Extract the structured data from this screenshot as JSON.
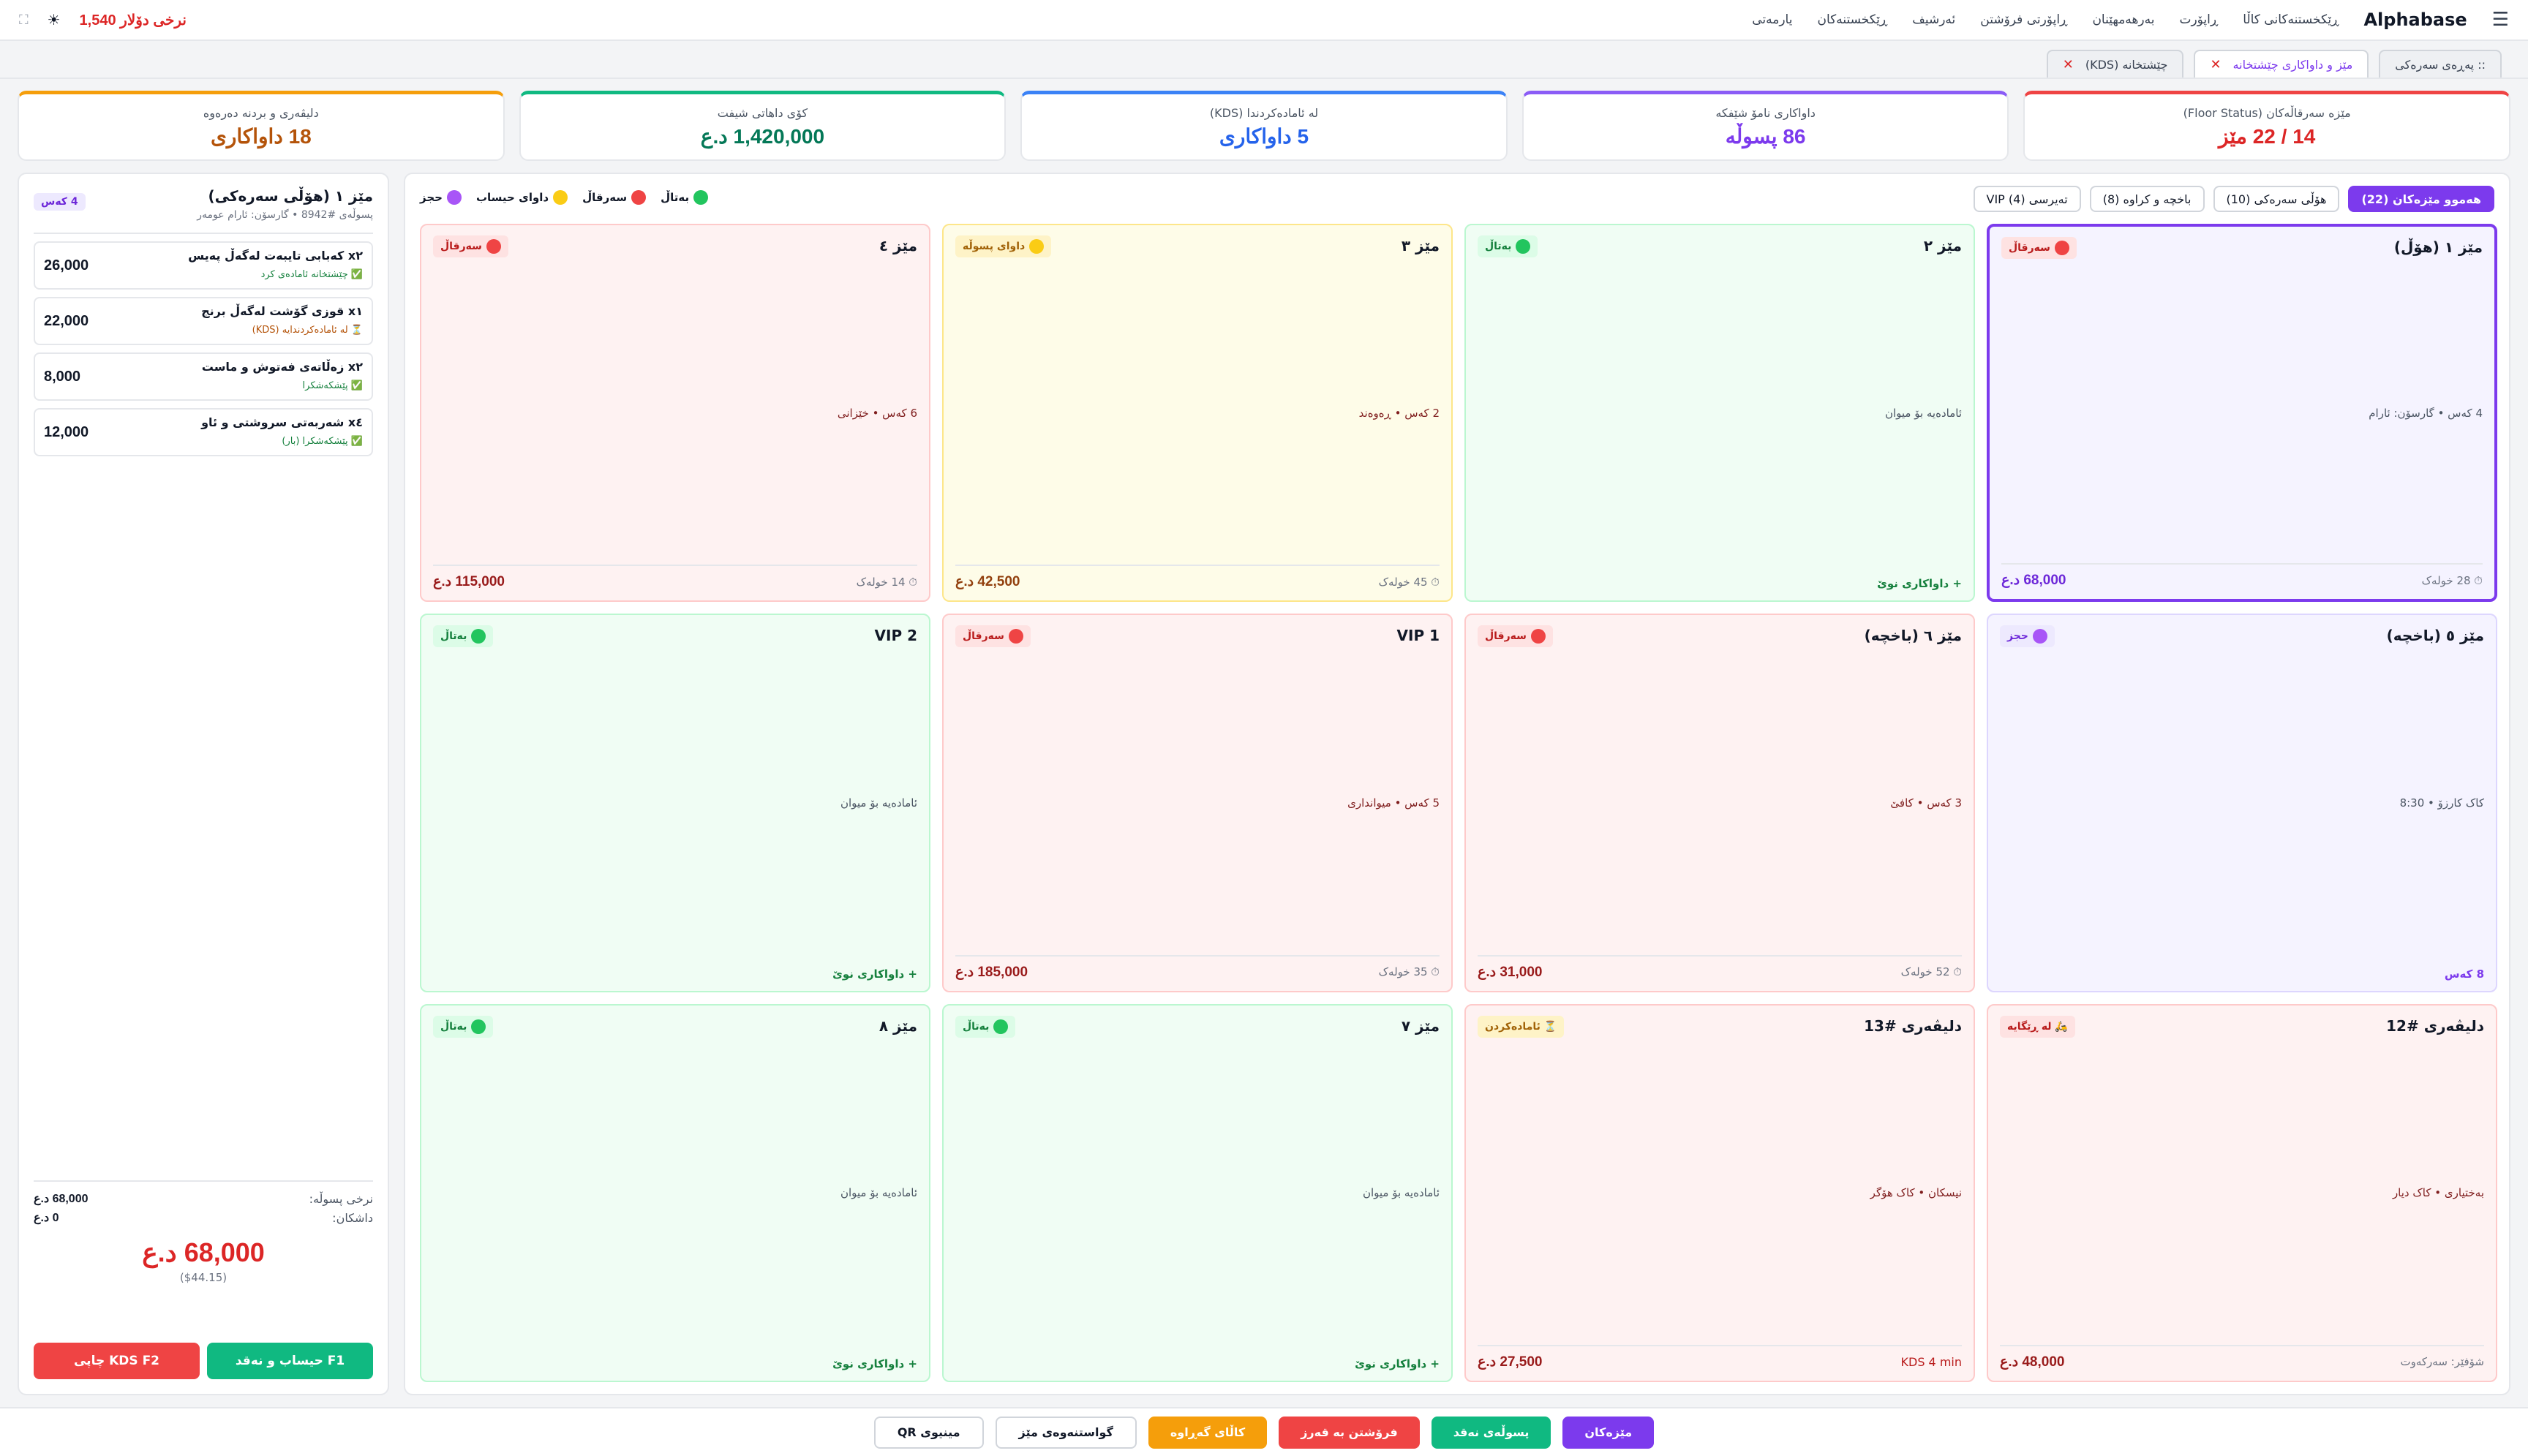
{
  "nav": {
    "brand": "Alphabase",
    "menu_icon": "hamburger-icon",
    "links": [
      "ڕێکخستنەکانی کاڵا",
      "ڕاپۆرت",
      "بەرهەمهێنان",
      "ڕاپۆرتی فرۆشتن",
      "ئەرشیف",
      "ڕێکخستنەکان",
      "یارمەتی"
    ],
    "rate_text": "نرخی دۆلار 1,540"
  },
  "tabs": [
    {
      "label": ":: پەڕەی سەرەکی"
    },
    {
      "label": "مێز و داواکاری چێشتخانە"
    },
    {
      "label": "چێشتخانە (KDS)"
    }
  ],
  "kpis": [
    {
      "label": "مێزە سەرقاڵەکان (Floor Status)",
      "value": "14 / 22 مێز",
      "color": "#ef4444",
      "text": "#dc2626"
    },
    {
      "label": "داواکاری نامۆ شێفکە",
      "value": "86 پسوڵە",
      "color": "#8b5cf6",
      "text": "#7c3aed"
    },
    {
      "label": "لە ئامادەکردندا (KDS)",
      "value": "5 داواکاری",
      "color": "#3b82f6",
      "text": "#2563eb"
    },
    {
      "label": "کۆی داهاتی شیفت",
      "value": "1,420,000 د.ع",
      "color": "#10b981",
      "text": "#047857"
    },
    {
      "label": "دلیڤەری و بردنە دەرەوە",
      "value": "18 داواکاری",
      "color": "#f59e0b",
      "text": "#b45309"
    }
  ],
  "filters": [
    "هەموو مێزەکان (22)",
    "هۆڵی سەرەکی (10)",
    "باخچە و کراوە (8)",
    "تەیرسی VIP (4)"
  ],
  "legend": [
    {
      "label": "بەتاڵ",
      "color": "#22c55e"
    },
    {
      "label": "سەرقاڵ",
      "color": "#ef4444"
    },
    {
      "label": "داوای حیساب",
      "color": "#facc15"
    },
    {
      "label": "حجز",
      "color": "#a855f7"
    }
  ],
  "cards": [
    {
      "title": "مێز ١ (هۆڵ)",
      "cls": "sel",
      "badge": "سەرقاڵ",
      "bcls": "b-occ",
      "dot": "#ef4444",
      "mid": "4 کەس • گارسۆن: ئارام",
      "amount": "68,000 د.ع",
      "acls": "amt p",
      "right": "⏱ 28 خولەک",
      "rcls": "tm",
      "mcls": ""
    },
    {
      "title": "مێز ٢",
      "cls": "free",
      "badge": "بەتاڵ",
      "bcls": "b-free",
      "dot": "#22c55e",
      "mid": "ئامادەیە بۆ میوان",
      "amount": "",
      "acls": "",
      "right": "+ داواکاری نوێ",
      "rcls": "newo",
      "mcls": ""
    },
    {
      "title": "مێز ٣",
      "cls": "bill",
      "badge": "داوای پسوڵە",
      "bcls": "b-bill",
      "dot": "#facc15",
      "mid": "2 کەس • ڕەوەند",
      "amount": "42,500 د.ع",
      "acls": "amt y",
      "right": "⏱ 45 خولەک",
      "rcls": "tm",
      "mcls": "dark"
    },
    {
      "title": "مێز ٤",
      "cls": "occ",
      "badge": "سەرقاڵ",
      "bcls": "b-occ",
      "dot": "#ef4444",
      "mid": "6 کەس • خێزانی",
      "amount": "115,000 د.ع",
      "acls": "amt",
      "right": "⏱ 14 خولەک",
      "rcls": "tm",
      "mcls": "dark"
    },
    {
      "title": "مێز ٥ (باخچە)",
      "cls": "res",
      "badge": "حجز",
      "bcls": "b-res",
      "dot": "#a855f7",
      "mid": "کاک کارزۆ • 8:30",
      "amount": "",
      "acls": "",
      "right": "8 کەس",
      "rcls": "guests",
      "mcls": ""
    },
    {
      "title": "مێز ٦ (باخچە)",
      "cls": "occ",
      "badge": "سەرقاڵ",
      "bcls": "b-occ",
      "dot": "#ef4444",
      "mid": "3 کەس • کافێ",
      "amount": "31,000 د.ع",
      "acls": "amt",
      "right": "⏱ 52 خولەک",
      "rcls": "tm",
      "mcls": "dark"
    },
    {
      "title": "VIP 1",
      "cls": "occ",
      "badge": "سەرقاڵ",
      "bcls": "b-occ",
      "dot": "#ef4444",
      "mid": "5 کەس • میوانداری",
      "amount": "185,000 د.ع",
      "acls": "amt",
      "right": "⏱ 35 خولەک",
      "rcls": "tm",
      "mcls": "dark"
    },
    {
      "title": "VIP 2",
      "cls": "free",
      "badge": "بەتاڵ",
      "bcls": "b-free",
      "dot": "#22c55e",
      "mid": "ئامادەیە بۆ میوان",
      "amount": "",
      "acls": "",
      "right": "+ داواکاری نوێ",
      "rcls": "newo",
      "mcls": ""
    },
    {
      "title": "دلیڤەری #12",
      "cls": "occ",
      "badge": "🛵 لە ڕێگایە",
      "bcls": "b-occ",
      "dot": "",
      "mid": "بەختیاری • کاک دیار",
      "amount": "48,000 د.ع",
      "acls": "amt",
      "right": "شۆفێر: سەرکەوت",
      "rcls": "tm",
      "mcls": "dark"
    },
    {
      "title": "دلیڤەری #13",
      "cls": "occ",
      "badge": "⏳ ئامادەکردن",
      "bcls": "b-bill",
      "dot": "",
      "mid": "نیسکان • کاک هۆگر",
      "amount": "27,500 د.ع",
      "acls": "amt",
      "right": "KDS 4 min",
      "rcls": "kds",
      "mcls": "dark"
    },
    {
      "title": "مێز ٧",
      "cls": "free",
      "badge": "بەتاڵ",
      "bcls": "b-free",
      "dot": "#22c55e",
      "mid": "ئامادەیە بۆ میوان",
      "amount": "",
      "acls": "",
      "right": "+ داواکاری نوێ",
      "rcls": "newo",
      "mcls": ""
    },
    {
      "title": "مێز ٨",
      "cls": "free",
      "badge": "بەتاڵ",
      "bcls": "b-free",
      "dot": "#22c55e",
      "mid": "ئامادەیە بۆ میوان",
      "amount": "",
      "acls": "",
      "right": "+ داواکاری نوێ",
      "rcls": "newo",
      "mcls": ""
    }
  ],
  "order": {
    "title": "مێز ١ (هۆڵی سەرەکی)",
    "sub": "پسوڵەی #8942 • گارسۆن: ئارام عومەر",
    "badge": "4 کەس",
    "items": [
      {
        "name": "x٢ کەبابی تایبەت لەگەڵ پەیس",
        "status": "✅ چێشتخانە ئامادەی کرد",
        "scls": "s-ok",
        "price": "26,000"
      },
      {
        "name": "x١ قوزی گۆشت لەگەڵ برنج",
        "status": "⏳ لە ئامادەکردندایە (KDS)",
        "scls": "s-pend",
        "price": "22,000"
      },
      {
        "name": "x٢ زەڵاتەی فەتوش و ماست",
        "status": "✅ پێشکەشکرا",
        "scls": "s-ok",
        "price": "8,000"
      },
      {
        "name": "x٤ شەربەتی سروشتی و ئاو",
        "status": "✅ پێشکەشکرا (بار)",
        "scls": "s-ok",
        "price": "12,000"
      }
    ],
    "subtotal_label": "نرخی پسوڵە:",
    "subtotal": "68,000 د.ع",
    "discount_label": "داشکان:",
    "discount": "0 د.ع",
    "grand": "68,000 د.ع",
    "usd": "($44.15)",
    "pay_btn": "F1 حیساب و نەقد",
    "kds_btn": "KDS F2 چاپی"
  },
  "bottom": [
    {
      "label": "مێزەکان",
      "bg": "#7c3aed",
      "cls": ""
    },
    {
      "label": "پسوڵەی نەقد",
      "bg": "#10b981",
      "cls": ""
    },
    {
      "label": "فرۆشتن بە قەرز",
      "bg": "#ef4444",
      "cls": ""
    },
    {
      "label": "کاڵای گەڕاوە",
      "bg": "#f59e0b",
      "cls": ""
    },
    {
      "label": "گواستنەوەی مێز",
      "bg": "#fff",
      "cls": "out"
    },
    {
      "label": "مینیوی QR",
      "bg": "#fff",
      "cls": "out"
    }
  ]
}
